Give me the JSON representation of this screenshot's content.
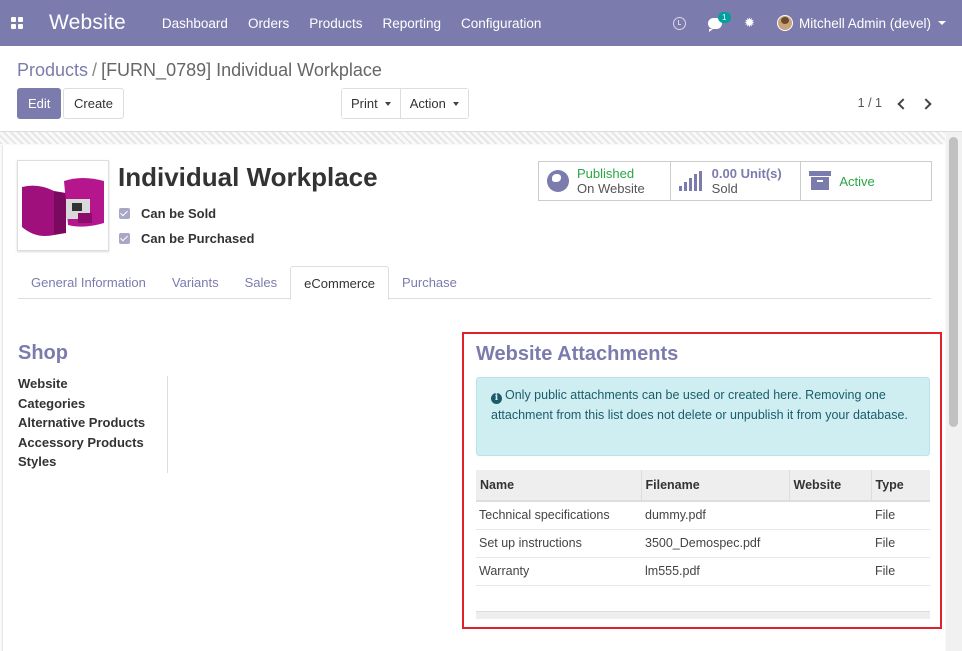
{
  "navbar": {
    "brand": "Website",
    "menu": [
      "Dashboard",
      "Orders",
      "Products",
      "Reporting",
      "Configuration"
    ],
    "chat_badge": "1",
    "user_name": "Mitchell Admin (devel)"
  },
  "control_panel": {
    "breadcrumb_parent": "Products",
    "breadcrumb_separator": "/",
    "breadcrumb_current": "[FURN_0789] Individual Workplace",
    "edit_label": "Edit",
    "create_label": "Create",
    "print_label": "Print",
    "action_label": "Action",
    "pager": "1 / 1"
  },
  "product": {
    "name": "Individual Workplace",
    "can_be_sold_label": "Can be Sold",
    "can_be_purchased_label": "Can be Purchased"
  },
  "smart_buttons": {
    "published_status": "Published",
    "published_sub": "On Website",
    "sold_value": "0.00 Unit(s)",
    "sold_label": "Sold",
    "active_label": "Active"
  },
  "tabs": [
    "General Information",
    "Variants",
    "Sales",
    "eCommerce",
    "Purchase"
  ],
  "active_tab": "eCommerce",
  "shop": {
    "title": "Shop",
    "fields": [
      "Website",
      "Categories",
      "Alternative Products",
      "Accessory Products",
      "Styles"
    ]
  },
  "attachments": {
    "title": "Website Attachments",
    "info_text": "Only public attachments can be used or created here. Removing one attachment from this list does not delete or unpublish it from your database.",
    "columns": [
      "Name",
      "Filename",
      "Website",
      "Type"
    ],
    "rows": [
      [
        "Technical specifications",
        "dummy.pdf",
        "",
        "File"
      ],
      [
        "Set up instructions",
        "3500_Demospec.pdf",
        "",
        "File"
      ],
      [
        "Warranty",
        "lm555.pdf",
        "",
        "File"
      ]
    ]
  },
  "colors": {
    "brand_purple": "#7c7bad",
    "active_green": "#28a745",
    "highlight_red": "#e0202b",
    "info_bg": "#cfeef2"
  },
  "icons": [
    "apps-grid-icon",
    "clock-icon",
    "chat-icon",
    "bug-icon",
    "globe-icon",
    "bar-chart-icon",
    "archive-icon",
    "info-circle-icon"
  ]
}
